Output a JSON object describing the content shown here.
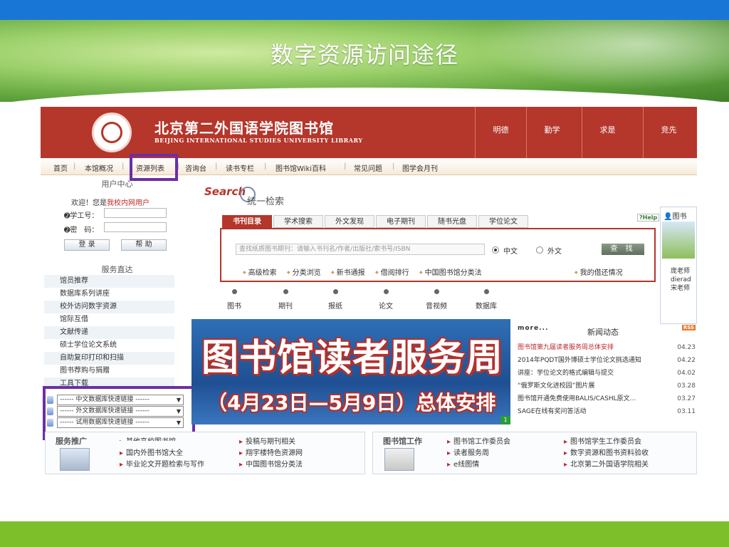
{
  "slide": {
    "title": "数字资源访问途径"
  },
  "library": {
    "name_cn": "北京第二外国语学院图书馆",
    "name_en": "BEIJING INTERNATIONAL STUDIES UNIVERSITY LIBRARY",
    "motto": [
      "明德",
      "勤学",
      "求是",
      "竞先"
    ],
    "brand_color": "#b5362a",
    "highlight_color": "#6b2fa6"
  },
  "nav": {
    "items": [
      "首页",
      "本馆概况",
      "资源列表",
      "咨询台",
      "读书专栏",
      "图书馆Wiki百科",
      "常见问题",
      "图学会月刊"
    ],
    "separator": "|"
  },
  "user_center": {
    "title": "用户中心",
    "welcome": "欢迎！您是",
    "welcome_user": "我校内网用户",
    "id_label": "学工号：",
    "password_label": "密　码：",
    "login_button": "登 录",
    "help_button": "帮 助"
  },
  "services": {
    "title": "服务直达",
    "items": [
      "馆员推荐",
      "数据库系列讲座",
      "校外访问数字资源",
      "馆际互借",
      "文献传递",
      "硕士学位论文系统",
      "自助复印打印和扫描",
      "图书荐购与捐赠"
    ],
    "partial_item": "工具下载"
  },
  "quick_links": [
    "------ 中文数据库快速链接 ------",
    "------ 外文数据库快速链接 ------",
    "------ 试用数据库快速链接 ------"
  ],
  "search": {
    "logo": "Search",
    "subtitle": "统一检索",
    "tabs": [
      "书刊目录",
      "学术搜索",
      "外文发现",
      "电子期刊",
      "随书光盘",
      "学位论文"
    ],
    "placeholder": "查找纸质图书期刊：请输入书刊名/作者/出版社/索书号/ISBN",
    "radio_cn": "中文",
    "radio_foreign": "外文",
    "button": "查 找",
    "links": [
      "高级检索",
      "分类浏览",
      "新书通报",
      "借阅排行",
      "中国图书馆分类法"
    ],
    "my_borrow": "我的借还情况",
    "help_badge": "?Help"
  },
  "categories": [
    "图书",
    "期刊",
    "报纸",
    "论文",
    "音视频",
    "数据库"
  ],
  "sidebar_card": {
    "title": "图书",
    "lines": [
      "庞老师",
      "dierad",
      "宋老师"
    ]
  },
  "promo": {
    "line1": "图书馆读者服务周",
    "line2": "（4月23日—5月9日）总体安排",
    "page": "1"
  },
  "news": {
    "more": "more...",
    "title": "新闻动态",
    "rss": "RSS",
    "items": [
      {
        "text": "图书馆第九届读者服务周总体安排",
        "date": "04.23",
        "hot": true
      },
      {
        "text": "2014年PQDT国外博硕士学位论文挑选通知",
        "date": "04.22",
        "hot": false
      },
      {
        "text": "讲座：学位论文的格式编辑与提交",
        "date": "04.02",
        "hot": false
      },
      {
        "text": "“俄罗斯文化进校园”图片展",
        "date": "03.28",
        "hot": false
      },
      {
        "text": "图书馆开通免费使用BALIS/CASHL原文...",
        "date": "03.27",
        "hot": false
      },
      {
        "text": "SAGE在线有奖问答活动",
        "date": "03.11",
        "hot": false
      }
    ]
  },
  "bottom": {
    "service_heading": "服务推广",
    "service_partial": "其他高校图书馆",
    "col1": [
      "国内外图书馆大全",
      "毕业论文开题检索与写作"
    ],
    "col2": [
      "投稿与期刊相关",
      "翔宇楼特色资源网",
      "中国图书馆分类法"
    ],
    "work_heading": "图书馆工作",
    "col3": [
      "图书馆工作委员会",
      "读者服务周",
      "e线图情"
    ],
    "col4": [
      "图书馆学生工作委员会",
      "数字资源和图书资料验收",
      "北京第二外国语学院相关"
    ]
  }
}
